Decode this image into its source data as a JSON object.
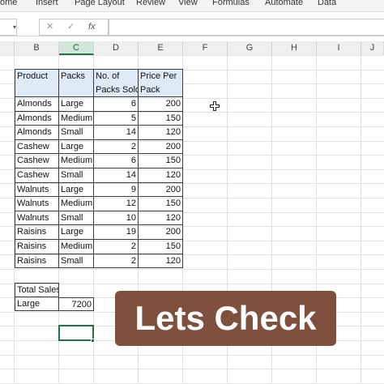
{
  "ribbon": {
    "tabs": [
      "ome",
      "Insert",
      "Page Layout",
      "Review",
      "View",
      "Formulas",
      "Automate",
      "Data"
    ]
  },
  "formula_bar": {
    "cancel_icon": "✕",
    "enter_icon": "✓",
    "fx_label": "fx",
    "content": ""
  },
  "columns": [
    "B",
    "C",
    "D",
    "E",
    "F",
    "G",
    "H",
    "I",
    "J"
  ],
  "active_column": "C",
  "table": {
    "headers": [
      "Product",
      "Packs",
      "No. of Packs Sold",
      "Price Per Pack"
    ],
    "headers_line1": [
      "",
      "",
      "No. of",
      "Price Per"
    ],
    "headers_line2": [
      "Product",
      "Packs",
      "Packs Sold",
      "Pack"
    ],
    "rows": [
      [
        "Almonds",
        "Large",
        "6",
        "200"
      ],
      [
        "Almonds",
        "Medium",
        "5",
        "150"
      ],
      [
        "Almonds",
        "Small",
        "14",
        "120"
      ],
      [
        "Cashew",
        "Large",
        "2",
        "200"
      ],
      [
        "Cashew",
        "Medium",
        "6",
        "150"
      ],
      [
        "Cashew",
        "Small",
        "14",
        "120"
      ],
      [
        "Walnuts",
        "Large",
        "9",
        "200"
      ],
      [
        "Walnuts",
        "Medium",
        "12",
        "150"
      ],
      [
        "Walnuts",
        "Small",
        "10",
        "120"
      ],
      [
        "Raisins",
        "Large",
        "19",
        "200"
      ],
      [
        "Raisins",
        "Medium",
        "2",
        "150"
      ],
      [
        "Raisins",
        "Small",
        "2",
        "120"
      ]
    ]
  },
  "summary": {
    "label": "Total Sales",
    "pack": "Large",
    "value": "7200"
  },
  "overlay": {
    "text": "Lets Check",
    "color": "#80503e"
  },
  "colors": {
    "header_fill": "#deebf7",
    "accent": "#217346"
  }
}
